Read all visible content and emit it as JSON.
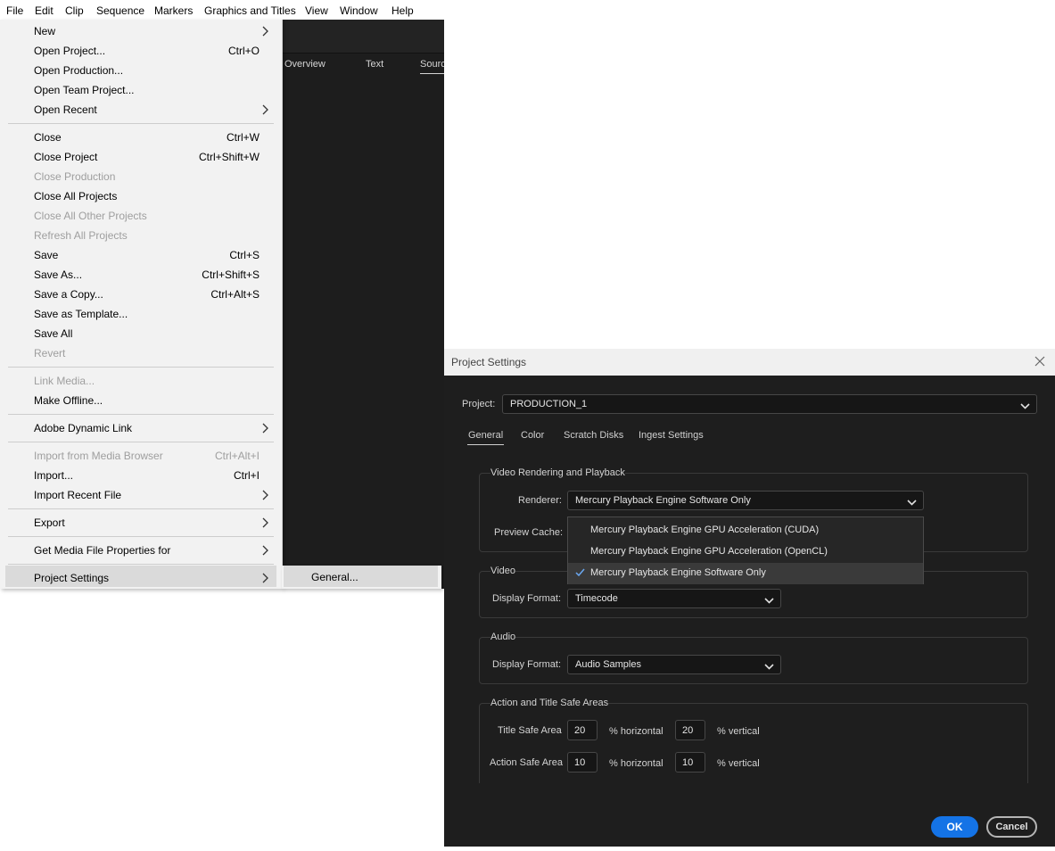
{
  "menubar": {
    "items": [
      "File",
      "Edit",
      "Clip",
      "Sequence",
      "Markers",
      "Graphics and Titles",
      "View",
      "Window",
      "Help"
    ]
  },
  "app": {
    "tabs": [
      "Overview",
      "Text",
      "Source"
    ]
  },
  "file_menu": {
    "items": [
      {
        "label": "New",
        "submenu": true
      },
      {
        "label": "Open Project...",
        "shortcut": "Ctrl+O"
      },
      {
        "label": "Open Production..."
      },
      {
        "label": "Open Team Project..."
      },
      {
        "label": "Open Recent",
        "submenu": true
      },
      {
        "label": "Close",
        "shortcut": "Ctrl+W"
      },
      {
        "label": "Close Project",
        "shortcut": "Ctrl+Shift+W"
      },
      {
        "label": "Close Production",
        "disabled": true
      },
      {
        "label": "Close All Projects"
      },
      {
        "label": "Close All Other Projects",
        "disabled": true
      },
      {
        "label": "Refresh All Projects",
        "disabled": true
      },
      {
        "label": "Save",
        "shortcut": "Ctrl+S"
      },
      {
        "label": "Save As...",
        "shortcut": "Ctrl+Shift+S"
      },
      {
        "label": "Save a Copy...",
        "shortcut": "Ctrl+Alt+S"
      },
      {
        "label": "Save as Template..."
      },
      {
        "label": "Save All"
      },
      {
        "label": "Revert",
        "disabled": true
      },
      {
        "label": "Link Media...",
        "disabled": true
      },
      {
        "label": "Make Offline..."
      },
      {
        "label": "Adobe Dynamic Link",
        "submenu": true
      },
      {
        "label": "Import from Media Browser",
        "shortcut": "Ctrl+Alt+I",
        "disabled": true
      },
      {
        "label": "Import...",
        "shortcut": "Ctrl+I"
      },
      {
        "label": "Import Recent File",
        "submenu": true
      },
      {
        "label": "Export",
        "submenu": true
      },
      {
        "label": "Get Media File Properties for",
        "submenu": true
      },
      {
        "label": "Project Settings",
        "submenu": true,
        "highlighted": true
      }
    ]
  },
  "submenu": {
    "general": "General..."
  },
  "dialog": {
    "title": "Project Settings",
    "project_label": "Project:",
    "project_value": "PRODUCTION_1",
    "tabs": [
      "General",
      "Color",
      "Scratch Disks",
      "Ingest Settings"
    ],
    "active_tab": "General",
    "sections": {
      "video_rendering": {
        "title": "Video Rendering and Playback",
        "renderer_label": "Renderer:",
        "renderer_value": "Mercury Playback Engine Software Only",
        "preview_cache_label": "Preview Cache:"
      },
      "video": {
        "title": "Video",
        "display_format_label": "Display Format:",
        "display_format_value": "Timecode"
      },
      "audio": {
        "title": "Audio",
        "display_format_label": "Display Format:",
        "display_format_value": "Audio Samples"
      },
      "safe_areas": {
        "title": "Action and Title Safe Areas",
        "title_safe_label": "Title Safe Area",
        "title_safe_h": "20",
        "title_safe_v": "20",
        "action_safe_label": "Action Safe Area",
        "action_safe_h": "10",
        "action_safe_v": "10",
        "horizontal_label": "% horizontal",
        "vertical_label": "% vertical"
      }
    },
    "renderer_options": [
      {
        "label": "Mercury Playback Engine GPU Acceleration (CUDA)",
        "selected": false
      },
      {
        "label": "Mercury Playback Engine GPU Acceleration (OpenCL)",
        "selected": false
      },
      {
        "label": "Mercury Playback Engine Software Only",
        "selected": true
      }
    ],
    "ok_label": "OK",
    "cancel_label": "Cancel"
  },
  "colors": {
    "accent": "#1473e6",
    "dialog_bg": "#1e1e1e",
    "menu_bg": "#f2f2f2"
  }
}
